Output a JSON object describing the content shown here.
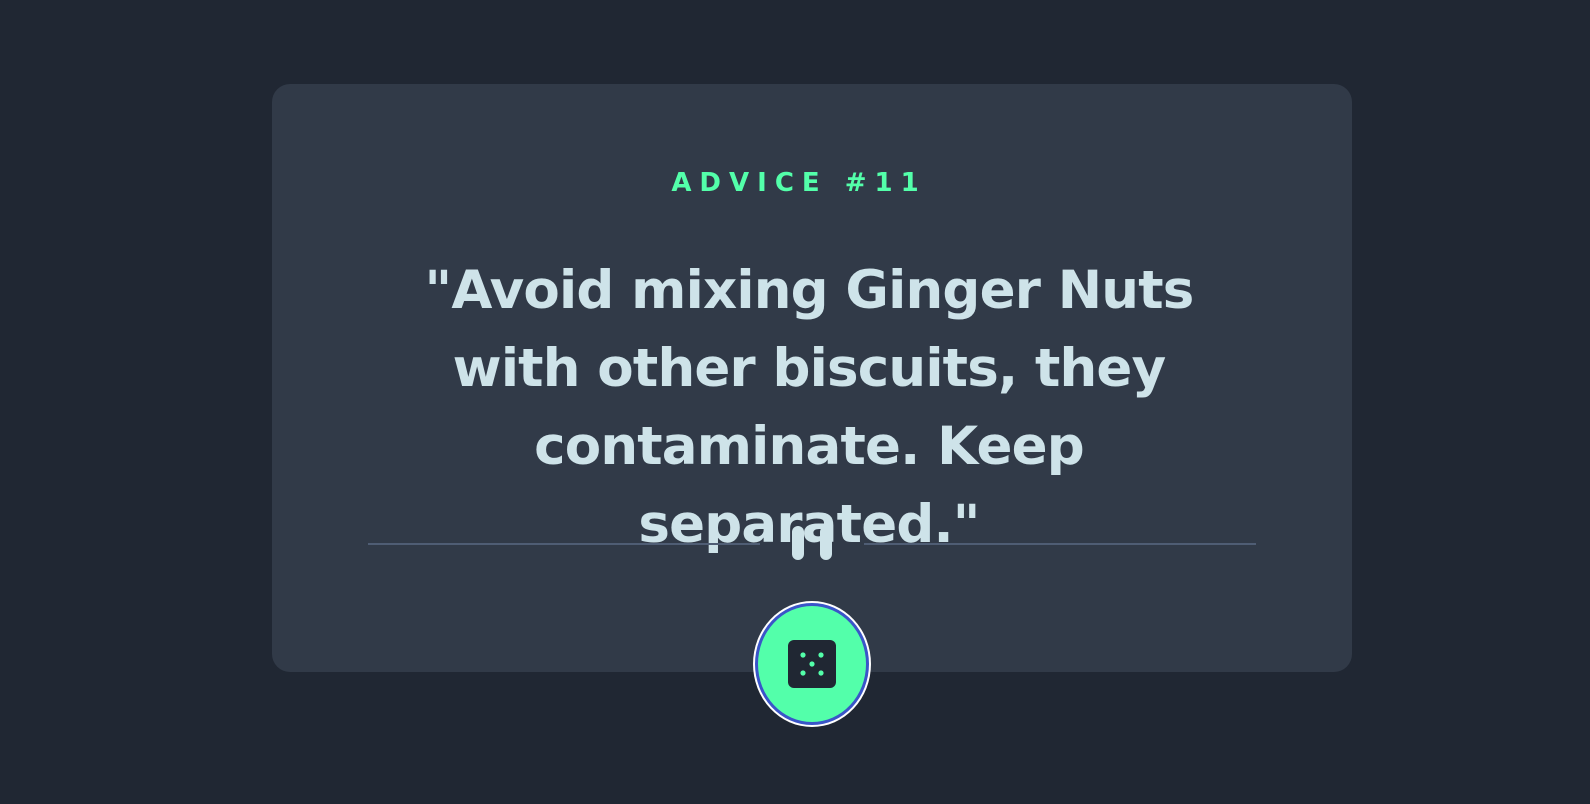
{
  "advice": {
    "label": "ADVICE #11",
    "quote": "\"Avoid mixing Ginger Nuts with other biscuits, they contaminate. Keep separated.\""
  },
  "divider": {
    "icon": "pause-icon"
  },
  "button": {
    "icon": "dice-icon"
  },
  "colors": {
    "background": "#202733",
    "card": "#313a48",
    "accent": "#53ffaa",
    "text": "#cee3e9",
    "divider": "#4f5d74"
  }
}
